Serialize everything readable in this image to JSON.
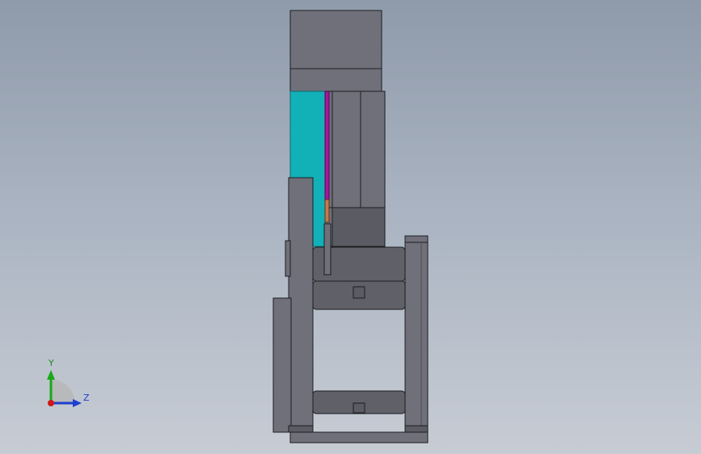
{
  "viewport": {
    "background_top": "#8f9aaa",
    "background_bottom": "#c7ccd4"
  },
  "model": {
    "body_color": "#6f7079",
    "body_dark": "#5a5b63",
    "edge_color": "#1d1e22",
    "cyan_color": "#12b1b8",
    "magenta_color": "#a7159f",
    "orange_color": "#c37a4f"
  },
  "triad": {
    "y_label": "Y",
    "z_label": "Z",
    "y_color": "#18a818",
    "z_color": "#1f3fcf",
    "origin_color": "#d01818"
  }
}
